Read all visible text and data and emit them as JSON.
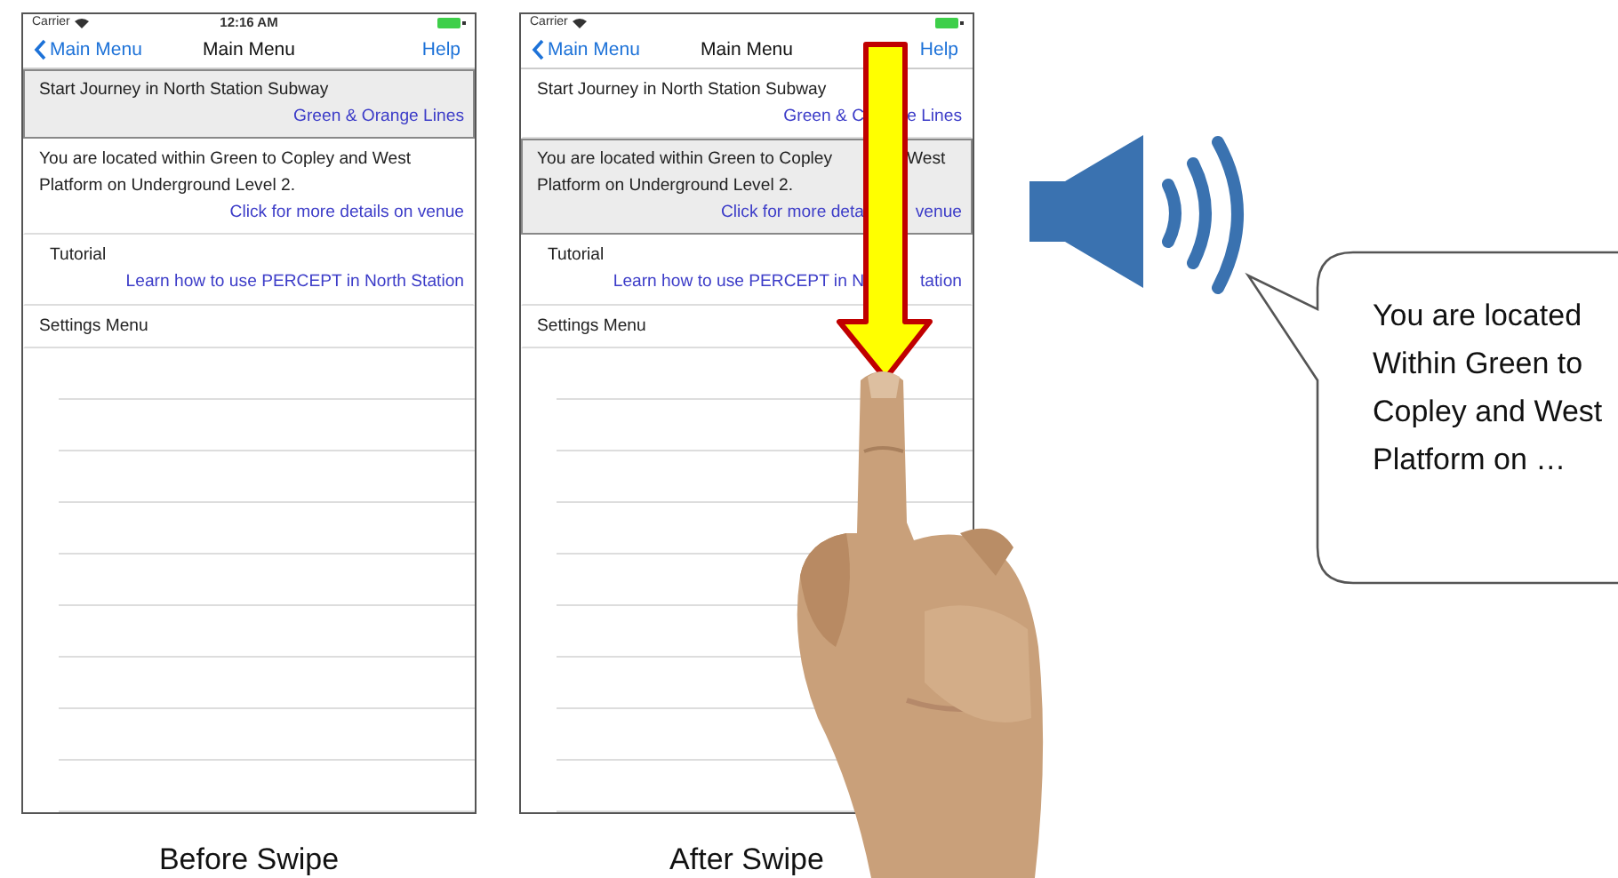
{
  "phones": [
    {
      "caption": "Before Swipe",
      "status": {
        "carrier": "Carrier",
        "time": "12:16 AM"
      },
      "nav": {
        "back": "Main Menu",
        "title": "Main Menu",
        "action": "Help"
      },
      "swipe_arrow": false,
      "rows": [
        {
          "kind": "item",
          "selected": true,
          "lines": [
            [
              "Start Journey in North Station Subway"
            ]
          ],
          "link": [
            "Green & Orange Lines"
          ]
        },
        {
          "kind": "item",
          "selected": false,
          "lines": [
            [
              "You are located within Green to Copley and West"
            ],
            [
              "Platform  on Underground Level 2."
            ]
          ],
          "link": [
            "Click for more details on venue"
          ]
        },
        {
          "kind": "section",
          "selected": false,
          "lines": [
            [
              "Tutorial"
            ]
          ],
          "link": [
            "Learn how to use PERCEPT in North Station"
          ]
        },
        {
          "kind": "item",
          "selected": false,
          "lines": [
            [
              "Settings Menu"
            ]
          ]
        }
      ]
    },
    {
      "caption": "After Swipe",
      "status": {
        "carrier": "Carrier"
      },
      "nav": {
        "back": "Main Menu",
        "title": "Main Menu",
        "action": "Help"
      },
      "swipe_arrow": true,
      "rows": [
        {
          "kind": "item",
          "selected": false,
          "lines": [
            [
              "Start Journey in North Station Subway"
            ]
          ],
          "link": [
            "Green & C",
            "e Lines"
          ]
        },
        {
          "kind": "item",
          "selected": true,
          "lines": [
            [
              "You are located within Green to Copley",
              "West"
            ],
            [
              "Platform  on Underground Level 2."
            ]
          ],
          "link": [
            "Click for more deta",
            "venue"
          ]
        },
        {
          "kind": "section",
          "selected": false,
          "lines": [
            [
              "Tutorial"
            ]
          ],
          "link": [
            "Learn how to use PERCEPT in N",
            "tation"
          ]
        },
        {
          "kind": "item",
          "selected": false,
          "lines": [
            [
              "Settings Menu"
            ]
          ]
        }
      ]
    }
  ],
  "speech": {
    "lines": [
      "You are located",
      "Within Green to",
      "Copley and West",
      "Platform on …"
    ]
  }
}
